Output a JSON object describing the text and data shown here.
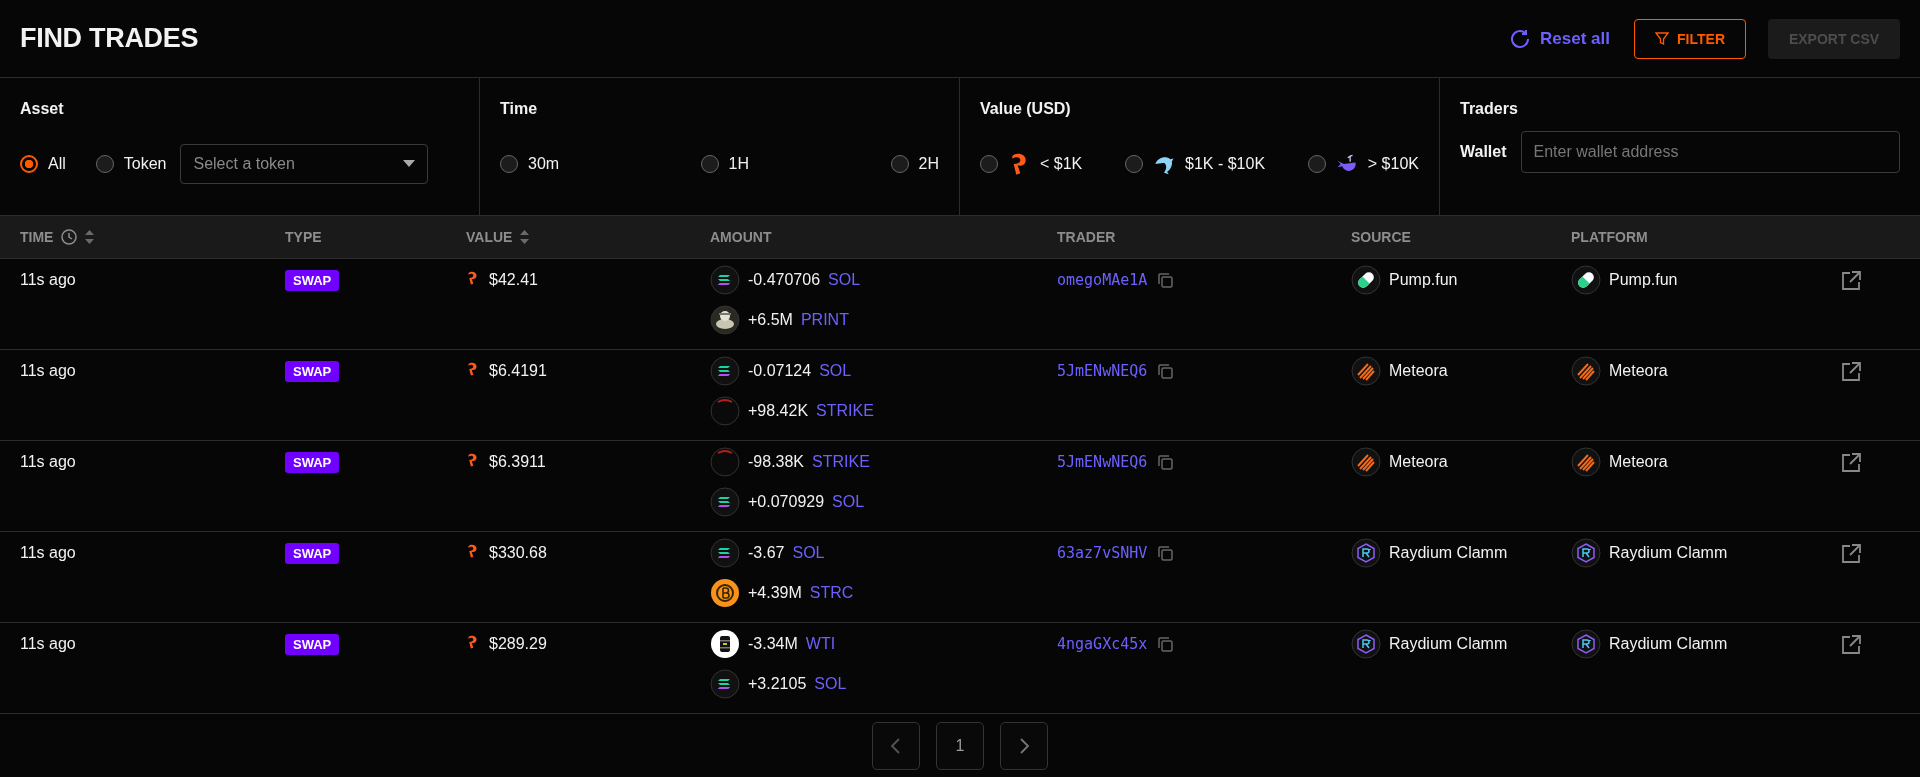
{
  "header": {
    "title": "FIND TRADES",
    "reset_label": "Reset all",
    "filter_label": "FILTER",
    "export_label": "EXPORT CSV",
    "export_disabled": true
  },
  "filters": {
    "asset": {
      "title": "Asset",
      "options": [
        {
          "label": "All",
          "selected": true
        },
        {
          "label": "Token",
          "selected": false
        }
      ],
      "token_select": {
        "placeholder": "Select a token"
      }
    },
    "time": {
      "title": "Time",
      "options": [
        {
          "label": "30m",
          "selected": false
        },
        {
          "label": "1H",
          "selected": false
        },
        {
          "label": "2H",
          "selected": false
        }
      ]
    },
    "value": {
      "title": "Value (USD)",
      "options": [
        {
          "label": "< $1K",
          "kind": "shrimp",
          "selected": false
        },
        {
          "label": "$1K - $10K",
          "kind": "dolphin",
          "selected": false
        },
        {
          "label": "> $10K",
          "kind": "whale",
          "selected": false
        }
      ]
    },
    "traders": {
      "title": "Traders",
      "wallet_label": "Wallet",
      "wallet_field": {
        "placeholder": "Enter wallet address"
      }
    }
  },
  "table": {
    "columns": [
      {
        "label": "TIME",
        "clock": true,
        "sortable": true
      },
      {
        "label": "TYPE",
        "clock": false,
        "sortable": false
      },
      {
        "label": "VALUE",
        "clock": false,
        "sortable": true
      },
      {
        "label": "AMOUNT",
        "clock": false,
        "sortable": false
      },
      {
        "label": "TRADER",
        "clock": false,
        "sortable": false
      },
      {
        "label": "SOURCE",
        "clock": false,
        "sortable": false
      },
      {
        "label": "PLATFORM",
        "clock": false,
        "sortable": false
      }
    ],
    "rows": [
      {
        "time": "11s ago",
        "type": "SWAP",
        "value": "$42.41",
        "amounts": [
          {
            "kind": "sol",
            "amount": "-0.470706",
            "symbol": "SOL"
          },
          {
            "kind": "print",
            "amount": "+6.5M",
            "symbol": "PRINT"
          }
        ],
        "trader": "omegoMAe1A",
        "source": {
          "kind": "pump",
          "name": "Pump.fun"
        },
        "platform": {
          "kind": "pump",
          "name": "Pump.fun"
        }
      },
      {
        "time": "11s ago",
        "type": "SWAP",
        "value": "$6.4191",
        "amounts": [
          {
            "kind": "sol",
            "amount": "-0.07124",
            "symbol": "SOL"
          },
          {
            "kind": "strike",
            "amount": "+98.42K",
            "symbol": "STRIKE"
          }
        ],
        "trader": "5JmENwNEQ6",
        "source": {
          "kind": "meteora",
          "name": "Meteora"
        },
        "platform": {
          "kind": "meteora",
          "name": "Meteora"
        }
      },
      {
        "time": "11s ago",
        "type": "SWAP",
        "value": "$6.3911",
        "amounts": [
          {
            "kind": "strike",
            "amount": "-98.38K",
            "symbol": "STRIKE"
          },
          {
            "kind": "sol",
            "amount": "+0.070929",
            "symbol": "SOL"
          }
        ],
        "trader": "5JmENwNEQ6",
        "source": {
          "kind": "meteora",
          "name": "Meteora"
        },
        "platform": {
          "kind": "meteora",
          "name": "Meteora"
        }
      },
      {
        "time": "11s ago",
        "type": "SWAP",
        "value": "$330.68",
        "amounts": [
          {
            "kind": "sol",
            "amount": "-3.67",
            "symbol": "SOL"
          },
          {
            "kind": "btc",
            "amount": "+4.39M",
            "symbol": "STRC"
          }
        ],
        "trader": "63az7vSNHV",
        "source": {
          "kind": "raydium",
          "name": "Raydium Clamm"
        },
        "platform": {
          "kind": "raydium",
          "name": "Raydium Clamm"
        }
      },
      {
        "time": "11s ago",
        "type": "SWAP",
        "value": "$289.29",
        "amounts": [
          {
            "kind": "wti",
            "amount": "-3.34M",
            "symbol": "WTI"
          },
          {
            "kind": "sol",
            "amount": "+3.2105",
            "symbol": "SOL"
          }
        ],
        "trader": "4ngaGXc45x",
        "source": {
          "kind": "raydium",
          "name": "Raydium Clamm"
        },
        "platform": {
          "kind": "raydium",
          "name": "Raydium Clamm"
        }
      }
    ]
  },
  "pagination": {
    "page": "1"
  }
}
